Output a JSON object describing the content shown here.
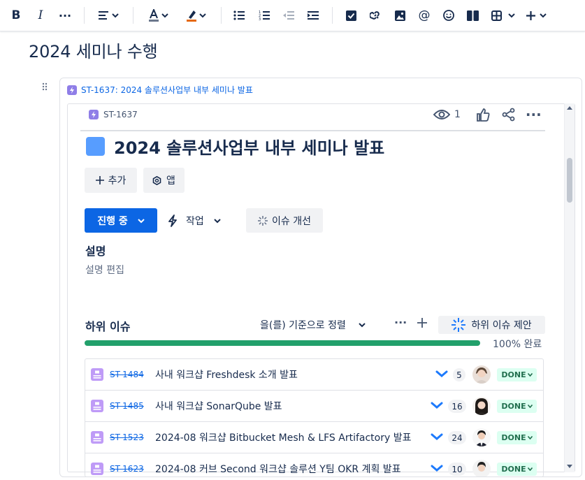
{
  "toolbar": {
    "items": [
      "bold-button",
      "italic-button",
      "more-formatting-button",
      "text-styles-button",
      "text-color-button",
      "highlight-button",
      "bullet-list-button",
      "numbered-list-button",
      "outdent-button",
      "indent-button",
      "action-item-button",
      "link-button",
      "image-button",
      "mention-button",
      "emoji-button",
      "layouts-button",
      "table-button",
      "insert-button"
    ]
  },
  "page": {
    "title": "2024 세미나 수행"
  },
  "embed": {
    "link_text": "ST-1637: 2024 솔루션사업부 내부 세미나 발표"
  },
  "issue": {
    "key": "ST-1637",
    "watchers": "1",
    "title": "2024 솔루션사업부 내부 세미나 발표",
    "add_label": "추가",
    "apps_label": "앱",
    "status_label": "진행 중",
    "action_label": "작업",
    "improve_label": "이슈 개선",
    "description_heading": "설명",
    "description_placeholder": "설명 편집",
    "type_color": "#579dff"
  },
  "subtasks": {
    "heading": "하위 이슈",
    "sort_label": "을(를) 기준으로 정렬",
    "suggest_label": "하위 이슈 제안",
    "progress_percent": 100,
    "progress_label": "100% 완료",
    "rows": [
      {
        "key": "ST-1484",
        "summary": "사내 워크샵 Freshdesk 소개 발표",
        "points": "5",
        "status": "DONE"
      },
      {
        "key": "ST-1485",
        "summary": "사내 워크샵 SonarQube 발표",
        "points": "16",
        "status": "DONE"
      },
      {
        "key": "ST-1523",
        "summary": "2024-08 워크샵 Bitbucket Mesh & LFS Artifactory 발표",
        "points": "24",
        "status": "DONE"
      },
      {
        "key": "ST-1623",
        "summary": "2024-08 커브 Second 워크샵 솔루션 Y팀 OKR 계획 발표",
        "points": "10",
        "status": "DONE"
      }
    ]
  },
  "colors": {
    "primary": "#0c66e4",
    "done": "#216e4e",
    "progress": "#22a06b"
  }
}
